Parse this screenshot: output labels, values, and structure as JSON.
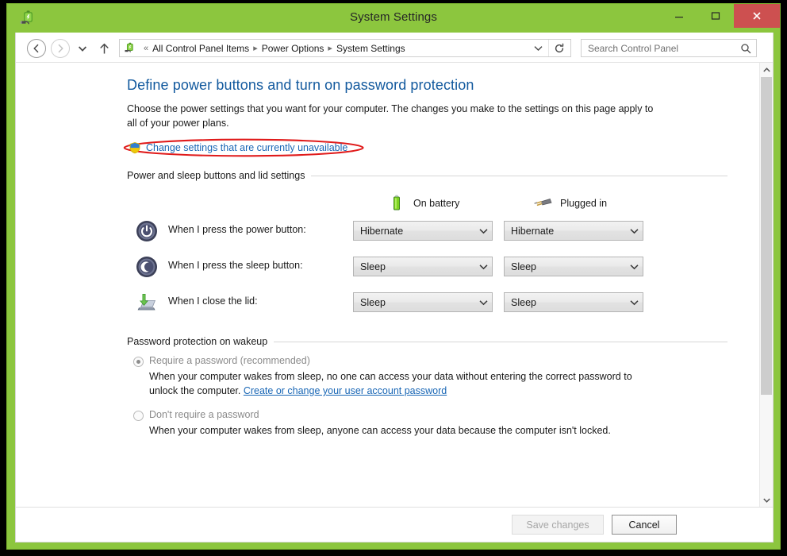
{
  "window": {
    "title": "System Settings",
    "icon": "power-options-icon",
    "controls": {
      "minimize": "minimize-icon",
      "maximize": "maximize-icon",
      "close": "close-icon"
    },
    "accent_green": "#8cc63e",
    "close_red": "#cd5050"
  },
  "nav": {
    "back": "back-arrow-icon",
    "forward": "forward-arrow-icon",
    "recent": "recent-locations-icon",
    "up": "up-arrow-icon",
    "address_icon": "power-options-icon",
    "overflow": "«",
    "breadcrumbs": [
      "All Control Panel Items",
      "Power Options",
      "System Settings"
    ],
    "separator": "▸",
    "dropdown": "chevron-down-icon",
    "refresh": "refresh-icon"
  },
  "search": {
    "placeholder": "Search Control Panel",
    "icon": "search-icon"
  },
  "page": {
    "title": "Define power buttons and turn on password protection",
    "description": "Choose the power settings that you want for your computer. The changes you make to the settings on this page apply to all of your power plans.",
    "uac_link": "Change settings that are currently unavailable",
    "uac_icon": "shield-icon",
    "annotation_color": "#e01b1b"
  },
  "power_group": {
    "heading": "Power and sleep buttons and lid settings",
    "columns": [
      {
        "label": "On battery",
        "icon": "battery-icon"
      },
      {
        "label": "Plugged in",
        "icon": "power-plug-icon"
      }
    ],
    "rows": [
      {
        "icon": "power-button-icon",
        "label": "When I press the power button:",
        "on_battery": "Hibernate",
        "plugged_in": "Hibernate"
      },
      {
        "icon": "sleep-button-icon",
        "label": "When I press the sleep button:",
        "on_battery": "Sleep",
        "plugged_in": "Sleep"
      },
      {
        "icon": "laptop-lid-icon",
        "label": "When I close the lid:",
        "on_battery": "Sleep",
        "plugged_in": "Sleep"
      }
    ]
  },
  "password_group": {
    "heading": "Password protection on wakeup",
    "options": [
      {
        "title": "Require a password (recommended)",
        "selected": true,
        "desc_before": "When your computer wakes from sleep, no one can access your data without entering the correct password to unlock the computer. ",
        "link": "Create or change your user account password",
        "desc_after": ""
      },
      {
        "title": "Don't require a password",
        "selected": false,
        "desc_before": "When your computer wakes from sleep, anyone can access your data because the computer isn't locked.",
        "link": "",
        "desc_after": ""
      }
    ]
  },
  "footer": {
    "save_label": "Save changes",
    "cancel_label": "Cancel"
  },
  "scrollbar": {
    "up": "scroll-up-icon",
    "down": "scroll-down-icon"
  }
}
